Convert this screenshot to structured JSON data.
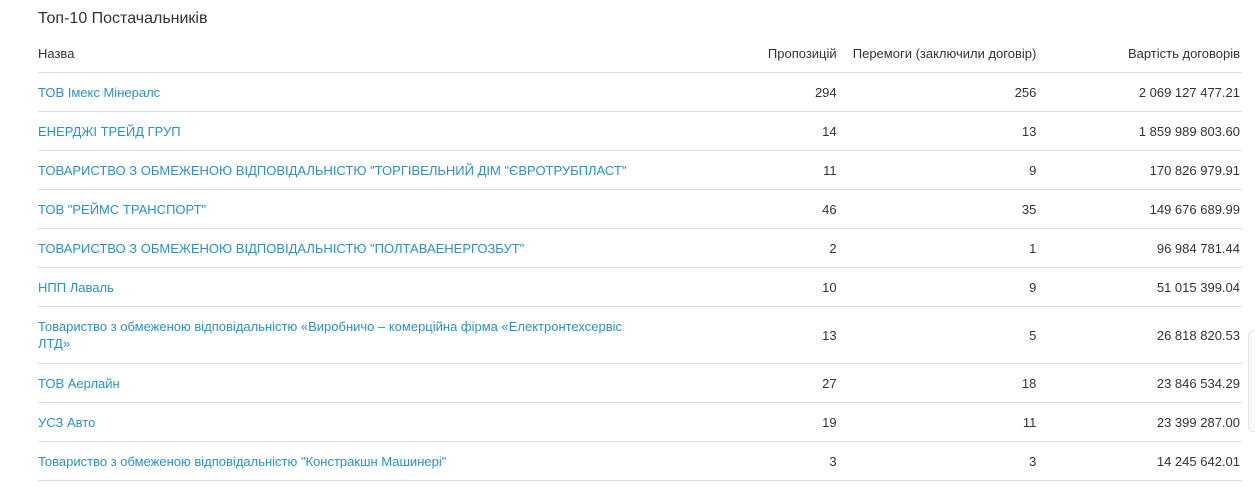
{
  "widget": {
    "title": "Топ-10 Постачальників"
  },
  "table": {
    "headers": {
      "name": "Назва",
      "proposals": "Пропозицій",
      "wins": "Перемоги (заключили договір)",
      "value": "Вартість договорів"
    },
    "rows": [
      {
        "name": "ТОВ Імекс Мінералс",
        "proposals": "294",
        "wins": "256",
        "value": "2 069 127 477.21"
      },
      {
        "name": "ЕНЕРДЖІ ТРЕЙД ГРУП",
        "proposals": "14",
        "wins": "13",
        "value": "1 859 989 803.60"
      },
      {
        "name": "ТОВАРИСТВО З ОБМЕЖЕНОЮ ВІДПОВІДАЛЬНІСТЮ \"ТОРГІВЕЛЬНИЙ ДІМ \"ЄВРОТРУБПЛАСТ\"",
        "proposals": "11",
        "wins": "9",
        "value": "170 826 979.91"
      },
      {
        "name": "ТОВ \"РЕЙМС ТРАНСПОРТ\"",
        "proposals": "46",
        "wins": "35",
        "value": "149 676 689.99"
      },
      {
        "name": "ТОВАРИСТВО З ОБМЕЖЕНОЮ ВІДПОВІДАЛЬНІСТЮ \"ПОЛТАВАЕНЕРГОЗБУТ\"",
        "proposals": "2",
        "wins": "1",
        "value": "96 984 781.44"
      },
      {
        "name": "НПП Лаваль",
        "proposals": "10",
        "wins": "9",
        "value": "51 015 399.04"
      },
      {
        "name": "Товариство з обмеженою відповідальністю «Виробничо – комерційна фірма «Електронтехсервіс ЛТД»",
        "proposals": "13",
        "wins": "5",
        "value": "26 818 820.53"
      },
      {
        "name": "ТОВ Аерлайн",
        "proposals": "27",
        "wins": "18",
        "value": "23 846 534.29"
      },
      {
        "name": "УСЗ Авто",
        "proposals": "19",
        "wins": "11",
        "value": "23 399 287.00"
      },
      {
        "name": "Товариство з обмеженою відповідальністю \"Констракшн Машинері\"",
        "proposals": "3",
        "wins": "3",
        "value": "14 245 642.01"
      }
    ]
  },
  "colors": {
    "link": "#2a91c4",
    "text": "#333333",
    "divider": "#dddddd"
  }
}
